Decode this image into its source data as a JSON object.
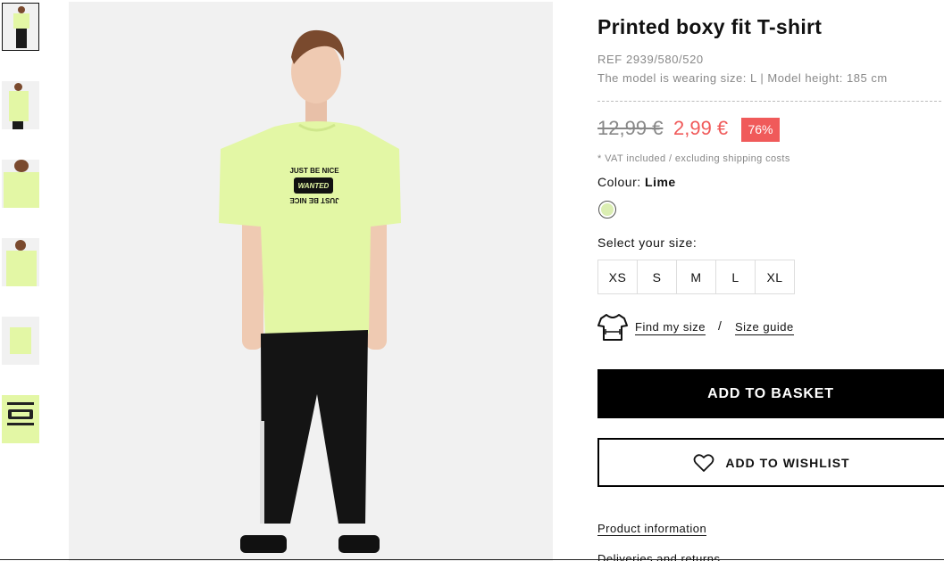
{
  "thumbnails": [
    "front-full",
    "side",
    "chest-closeup",
    "back-upper",
    "flat-shirt",
    "print-detail"
  ],
  "product": {
    "title": "Printed boxy fit T-shirt",
    "ref": "REF 2939/580/520",
    "model_info": "The model is wearing size: L | Model height: 185 cm",
    "old_price": "12,99 €",
    "new_price": "2,99 €",
    "discount": "76%",
    "vat_note": "* VAT included / excluding shipping costs",
    "colour_label": "Colour:",
    "colour_value": "Lime",
    "select_size": "Select your size:",
    "sizes": [
      "XS",
      "S",
      "M",
      "L",
      "XL"
    ],
    "find_size": "Find my size",
    "separator": "/",
    "size_guide": "Size guide",
    "add_basket": "ADD TO BASKET",
    "add_wishlist": "ADD TO WISHLIST",
    "product_information": "Product information",
    "deliveries": "Deliveries and returns"
  },
  "shirt_print": {
    "line1": "JUST BE NICE",
    "logo": "WANTED",
    "line2": "JUST BE NICE"
  },
  "colors": {
    "price_red": "#f05a5a",
    "lime": "#e3f7a5",
    "black": "#000000"
  }
}
